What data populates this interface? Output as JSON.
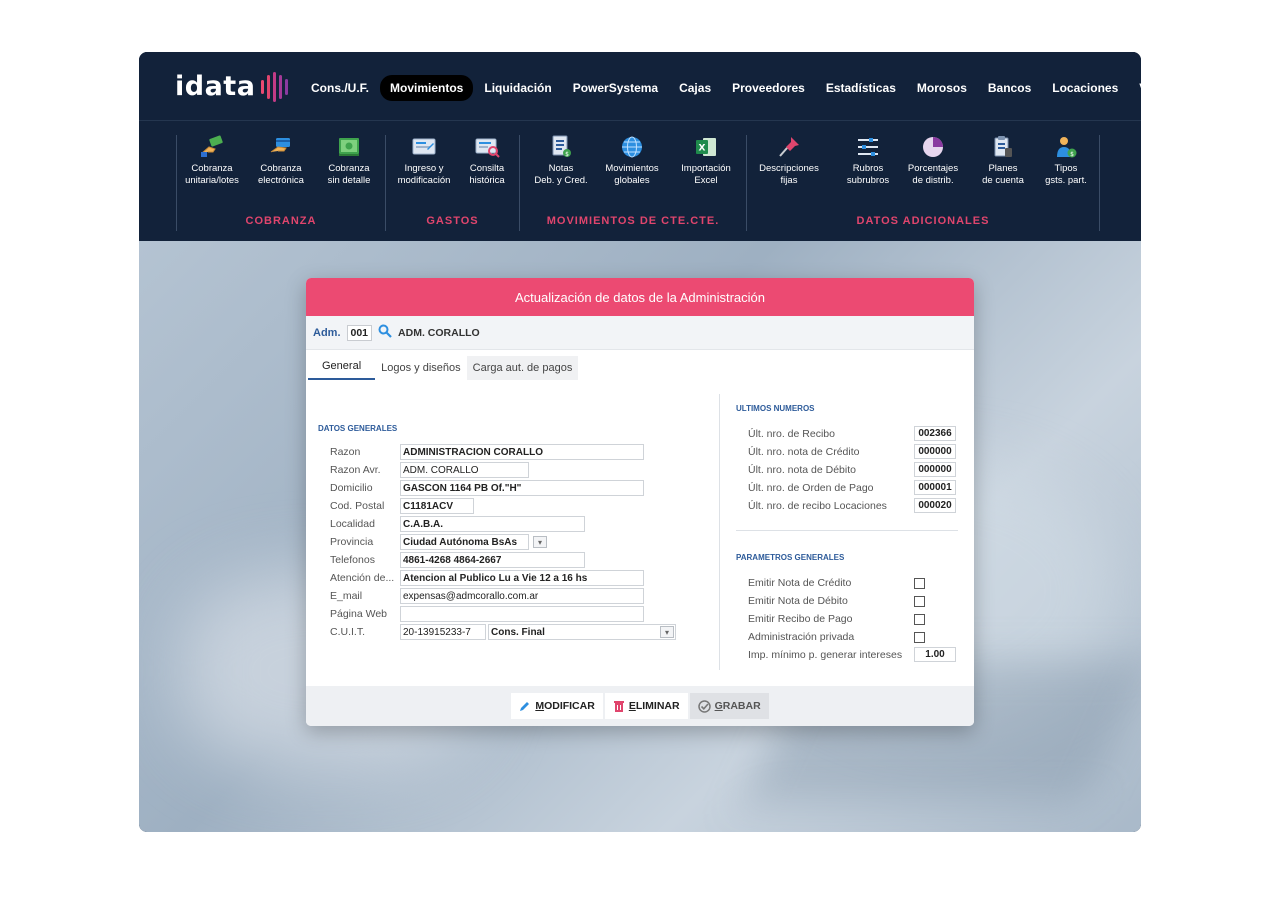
{
  "brand": {
    "logo_text": "idata",
    "accent": "#ec4a72"
  },
  "nav": {
    "items": [
      {
        "label": "Cons./U.F.",
        "active": false
      },
      {
        "label": "Movimientos",
        "active": true
      },
      {
        "label": "Liquidación",
        "active": false
      },
      {
        "label": "PowerSystema",
        "active": false
      },
      {
        "label": "Cajas",
        "active": false
      },
      {
        "label": "Proveedores",
        "active": false
      },
      {
        "label": "Estadísticas",
        "active": false
      },
      {
        "label": "Morosos",
        "active": false
      },
      {
        "label": "Bancos",
        "active": false
      },
      {
        "label": "Locaciones",
        "active": false
      },
      {
        "label": "Varios",
        "active": false
      }
    ]
  },
  "ribbon": {
    "cobranza": {
      "title": "COBRANZA",
      "tools": [
        {
          "line1": "Cobranza",
          "line2": "unitaria/lotes",
          "icon": "hand-money-icon"
        },
        {
          "line1": "Cobranza",
          "line2": "electrónica",
          "icon": "card-hand-icon"
        },
        {
          "line1": "Cobranza",
          "line2": "sin detalle",
          "icon": "cash-icon"
        }
      ]
    },
    "gastos": {
      "title": "GASTOS",
      "tools": [
        {
          "line1": "Ingreso y",
          "line2": "modificación",
          "icon": "screen-edit-icon"
        },
        {
          "line1": "Consilta",
          "line2": "histórica",
          "icon": "screen-search-icon"
        }
      ]
    },
    "movimientos": {
      "title": "MOVIMIENTOS DE CTE.CTE.",
      "tools": [
        {
          "line1": "Notas",
          "line2": "Deb. y Cred.",
          "icon": "notes-icon"
        },
        {
          "line1": "Movimientos",
          "line2": "globales",
          "icon": "globe-icon"
        },
        {
          "line1": "Importación",
          "line2": "Excel",
          "icon": "excel-icon"
        }
      ]
    },
    "datos": {
      "title": "DATOS ADICIONALES",
      "tools": [
        {
          "line1": "Descripciones",
          "line2": "fijas",
          "icon": "pin-icon"
        },
        {
          "line1": "Rubros",
          "line2": "subrubros",
          "icon": "sliders-icon"
        },
        {
          "line1": "Porcentajes",
          "line2": "de distrib.",
          "icon": "pie-icon"
        },
        {
          "line1": "Planes",
          "line2": "de cuenta",
          "icon": "clipboard-icon"
        },
        {
          "line1": "Tipos",
          "line2": "gsts. part.",
          "icon": "person-money-icon"
        }
      ]
    }
  },
  "dialog": {
    "title": "Actualización de datos de la Administración",
    "adm_label": "Adm.",
    "adm_code": "001",
    "adm_name": "ADM. CORALLO",
    "tabs": [
      "General",
      "Logos y diseños",
      "Carga aut. de pagos"
    ],
    "datos_generales": {
      "title": "DATOS GENERALES",
      "razon_label": "Razon",
      "razon": "ADMINISTRACION CORALLO",
      "razon_avr_label": "Razon Avr.",
      "razon_avr": "ADM. CORALLO",
      "domicilio_label": "Domicilio",
      "domicilio": "GASCON 1164 PB Of.\"H\"",
      "cod_postal_label": "Cod. Postal",
      "cod_postal": "C1181ACV",
      "localidad_label": "Localidad",
      "localidad": "C.A.B.A.",
      "provincia_label": "Provincia",
      "provincia": "Ciudad Autónoma BsAs",
      "telefonos_label": "Telefonos",
      "telefonos": "4861-4268 4864-2667",
      "atencion_label": "Atención de...",
      "atencion": "Atencion al Publico Lu a Vie 12 a 16 hs",
      "email_label": "E_mail",
      "email": "expensas@admcorallo.com.ar",
      "web_label": "Página Web",
      "web": "",
      "cuit_label": "C.U.I.T.",
      "cuit": "20-13915233-7",
      "iva": "Cons. Final"
    },
    "ultimos_numeros": {
      "title": "ULTIMOS NUMEROS",
      "rows": [
        {
          "label": "Últ. nro. de Recibo",
          "value": "002366"
        },
        {
          "label": "Últ. nro. nota de Crédito",
          "value": "000000"
        },
        {
          "label": "Últ. nro. nota de Débito",
          "value": "000000"
        },
        {
          "label": "Últ. nro. de Orden de Pago",
          "value": "000001"
        },
        {
          "label": "Últ. nro. de recibo Locaciones",
          "value": "000020"
        }
      ]
    },
    "parametros": {
      "title": "PARAMETROS GENERALES",
      "checks": [
        {
          "label": "Emitir Nota de Crédito",
          "checked": false
        },
        {
          "label": "Emitir Nota de Débito",
          "checked": false
        },
        {
          "label": "Emitir Recibo de Pago",
          "checked": false
        },
        {
          "label": "Administración privada",
          "checked": false
        }
      ],
      "imp_label": "Imp. mínimo p. generar intereses",
      "imp_value": "1.00"
    },
    "buttons": {
      "modificar_first": "M",
      "modificar_rest": "ODIFICAR",
      "eliminar_first": "E",
      "eliminar_rest": "LIMINAR",
      "grabar_first": "G",
      "grabar_rest": "RABAR"
    }
  }
}
